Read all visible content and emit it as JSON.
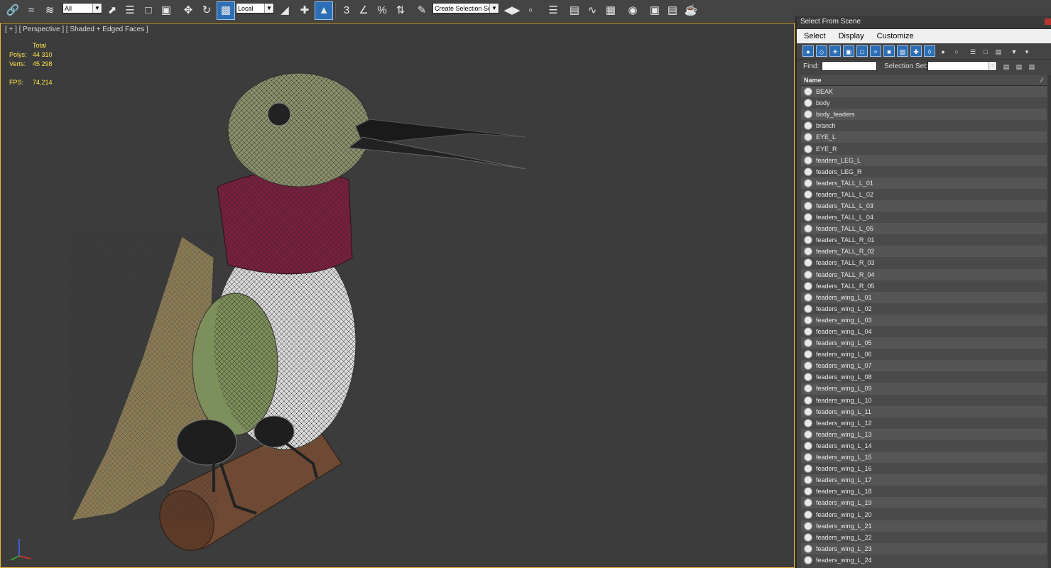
{
  "toolbar": {
    "selection_filter": "All",
    "coordinate_system": "Local",
    "named_selection_placeholder": "Create Selection Se",
    "snap_angle_label": "3",
    "percent_snap_label": "%",
    "icons": [
      "link-icon",
      "unlink-icon",
      "bind-spacewarp-icon",
      "select-object-icon",
      "select-by-name-icon",
      "rect-region-icon",
      "window-crossing-icon",
      "move-icon",
      "rotate-icon",
      "scale-icon",
      "use-pivot-icon",
      "select-manipulate-icon",
      "keyboard-shortcut-icon",
      "snaps-toggle-icon",
      "angle-snap-icon",
      "percent-snap-icon",
      "spinner-snap-icon",
      "edit-named-selections-icon",
      "mirror-icon",
      "align-icon",
      "layer-explorer-icon",
      "toggle-ribbon-icon",
      "curve-editor-icon",
      "schematic-view-icon",
      "material-editor-icon",
      "render-setup-icon",
      "rendered-frame-icon",
      "render-icon"
    ]
  },
  "viewport": {
    "label": "[ + ] [ Perspective ] [ Shaded + Edged Faces ]",
    "stats": {
      "header": "Total",
      "polys_label": "Polys:",
      "polys": "44 310",
      "verts_label": "Verts:",
      "verts": "45 298",
      "fps_label": "FPS:",
      "fps": "74,214"
    }
  },
  "panel": {
    "title": "Select From Scene",
    "menu": [
      "Select",
      "Display",
      "Customize"
    ],
    "find_label": "Find:",
    "selection_set_label": "Selection Set:",
    "column_header": "Name",
    "items": [
      "BEAK",
      "body",
      "body_feaders",
      "branch",
      "EYE_L",
      "EYE_R",
      "feaders_LEG_L",
      "feaders_LEG_R",
      "feaders_TALL_L_01",
      "feaders_TALL_L_02",
      "feaders_TALL_L_03",
      "feaders_TALL_L_04",
      "feaders_TALL_L_05",
      "feaders_TALL_R_01",
      "feaders_TALL_R_02",
      "feaders_TALL_R_03",
      "feaders_TALL_R_04",
      "feaders_TALL_R_05",
      "feaders_wing_L_01",
      "feaders_wing_L_02",
      "feaders_wing_L_03",
      "feaders_wing_L_04",
      "feaders_wing_L_05",
      "feaders_wing_L_06",
      "feaders_wing_L_07",
      "feaders_wing_L_08",
      "feaders_wing_L_09",
      "feaders_wing_L_10",
      "feaders_wing_L_11",
      "feaders_wing_L_12",
      "feaders_wing_L_13",
      "feaders_wing_L_14",
      "feaders_wing_L_15",
      "feaders_wing_L_16",
      "feaders_wing_L_17",
      "feaders_wing_L_18",
      "feaders_wing_L_19",
      "feaders_wing_L_20",
      "feaders_wing_L_21",
      "feaders_wing_L_22",
      "feaders_wing_L_23",
      "feaders_wing_L_24"
    ]
  },
  "colors": {
    "viewport_border": "#e8b838",
    "stats_text": "#ffe44a",
    "active_button": "#2d6fb6",
    "throat": "#7a1f3d",
    "belly": "#e4e4e4",
    "branch": "#6e4a35"
  }
}
